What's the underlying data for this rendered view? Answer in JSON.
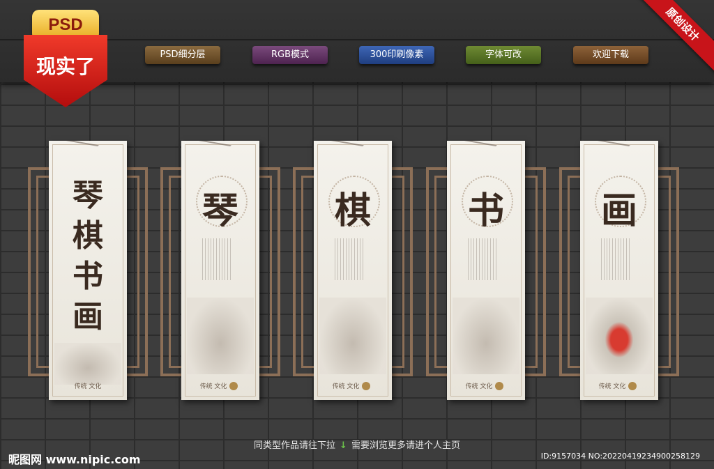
{
  "badge": {
    "psd": "PSD",
    "slogan": "现实了"
  },
  "ribbon": "原创设计",
  "features": [
    "PSD细分层",
    "RGB模式",
    "300印刷像素",
    "字体可改",
    "欢迎下载"
  ],
  "panels": [
    {
      "title_chars": [
        "琴",
        "棋",
        "书",
        "画"
      ],
      "footer": "传统 文化"
    },
    {
      "char": "琴",
      "footer": "传统 文化"
    },
    {
      "char": "棋",
      "footer": "传统 文化"
    },
    {
      "char": "书",
      "footer": "传统 文化"
    },
    {
      "char": "画",
      "footer": "传统 文化"
    }
  ],
  "bottom": {
    "hint_left": "同类型作品请往下拉",
    "hint_right": "需要浏览更多请进个人主页",
    "site_logo": "昵图网 www.nipic.com",
    "id_text": "ID:9157034 NO:20220419234900258129"
  },
  "colors": {
    "wall": "#3d3d3d",
    "badge_red": "#d81e1e",
    "ink": "#3a2a20",
    "frame": "#8c6f57"
  }
}
